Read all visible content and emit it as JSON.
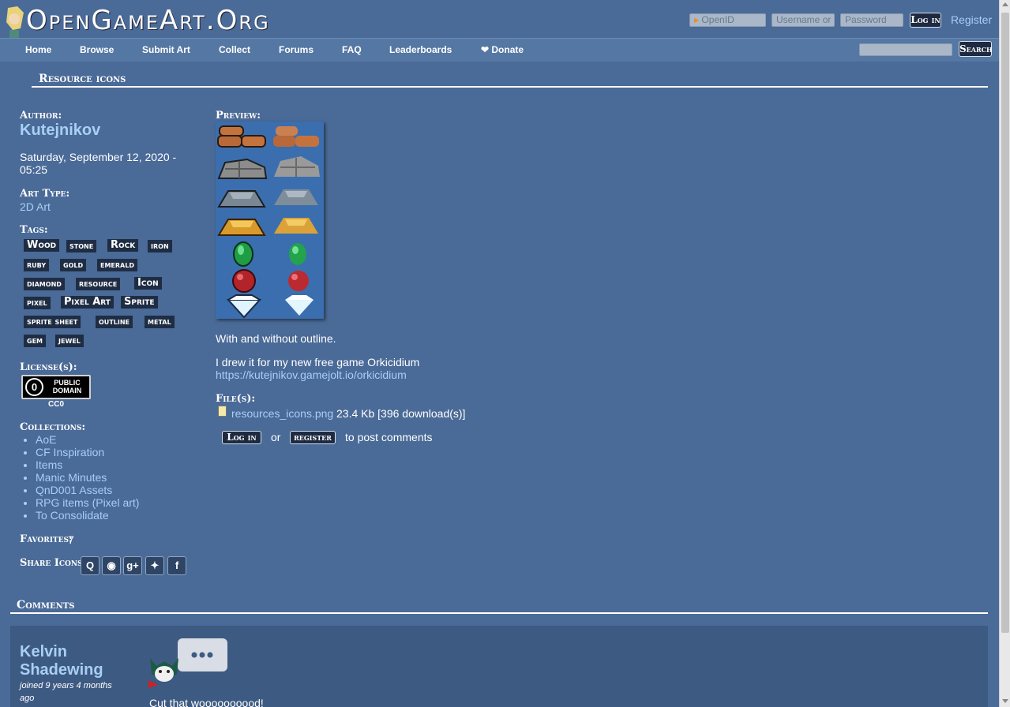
{
  "header": {
    "site_title": "OpenGameArt.Org",
    "nav": [
      "Home",
      "Browse",
      "Submit Art",
      "Collect",
      "Forums",
      "FAQ",
      "Leaderboards",
      "❤ Donate"
    ],
    "openid_placeholder": "OpenID",
    "username_placeholder": "Username or",
    "password_placeholder": "Password",
    "login_label": "Log in",
    "register_label": "Register",
    "search_label": "Search"
  },
  "page": {
    "title": "Resource icons",
    "author_label": "Author:",
    "author": "Kutejnikov",
    "date": "Saturday, September 12, 2020 - 05:25",
    "art_type_label": "Art Type:",
    "art_type": "2D Art",
    "tags_label": "Tags:",
    "tags": [
      "Wood",
      "stone",
      "Rock",
      "iron",
      "ruby",
      "gold",
      "emerald",
      "diamond",
      "resource",
      "Icon",
      "pixel",
      "Pixel Art",
      "Sprite",
      "sprite sheet",
      "outline",
      "metal",
      "gem",
      "jewel"
    ],
    "license_label": "License(s):",
    "license_badge_text": "PUBLIC DOMAIN",
    "license_name": "CC0",
    "collections_label": "Collections:",
    "collections": [
      "AoE",
      "CF Inspiration",
      "Items",
      "Manic Minutes",
      "QnD001 Assets",
      "RPG items (Pixel art)",
      "To Consolidate"
    ],
    "favorites_label": "Favorites:",
    "favorites": "7",
    "share_label": "Share Icons:",
    "share_icons": [
      "delicious-icon",
      "reddit-icon",
      "google-plus-icon",
      "twitter-icon",
      "facebook-icon"
    ],
    "preview_label": "Preview:",
    "description_1": "With and without outline.",
    "description_2": "I drew it for my new free game Orkicidium",
    "link": "https://kutejnikov.gamejolt.io/orkicidium",
    "files_label": "File(s):",
    "file_name": "resources_icons.png",
    "file_info": "23.4 Kb [396 download(s)]",
    "login_btn": "Log in",
    "or_text": "or",
    "register_btn": "register",
    "post_comments_text": "to post comments"
  },
  "comments": {
    "header": "Comments",
    "commenter": "Kelvin Shadewing",
    "joined": "joined 9 years 4 months ago",
    "text": "Cut that woooooooood!"
  },
  "colors": {
    "background": "#4a6a97",
    "link": "#a8cff5",
    "tag_bg": "#1f2d44"
  }
}
